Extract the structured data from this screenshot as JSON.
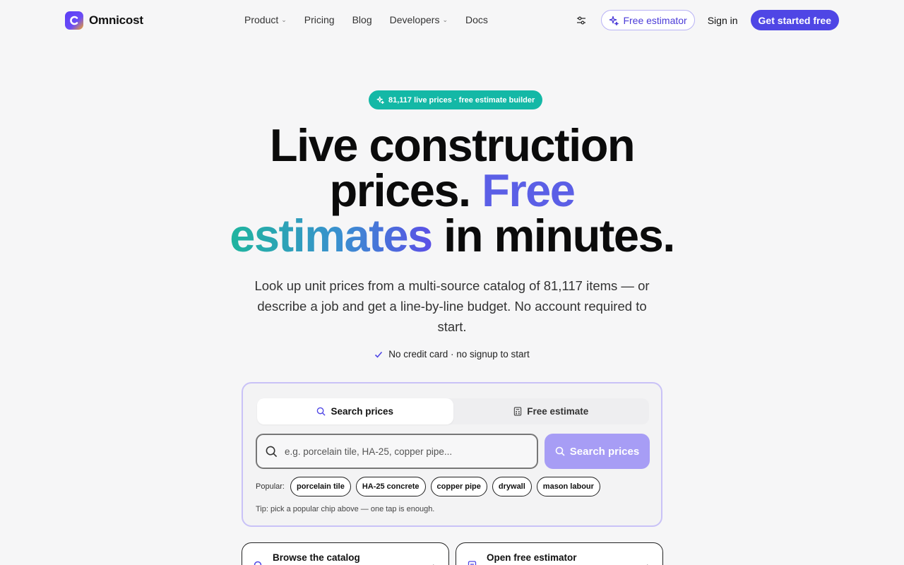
{
  "brand": {
    "name": "Omnicost"
  },
  "nav": {
    "links": [
      {
        "label": "Product",
        "dropdown": true
      },
      {
        "label": "Pricing",
        "dropdown": false
      },
      {
        "label": "Blog",
        "dropdown": false
      },
      {
        "label": "Developers",
        "dropdown": true
      },
      {
        "label": "Docs",
        "dropdown": false
      }
    ],
    "free_estimator_label": "Free estimator",
    "signin_label": "Sign in",
    "cta_label": "Get started free"
  },
  "hero": {
    "pill": "81,117 live prices · free estimate builder",
    "headline": {
      "line1": "Live construction",
      "line2_a": "prices. ",
      "line2_b": "Free",
      "line3_a": "estimates",
      "line3_b": " in minutes."
    },
    "subtitle": "Look up unit prices from a multi-source catalog of 81,117 items — or describe a job and get a line-by-line budget. No account required to start.",
    "note": "No credit card · no signup to start"
  },
  "search_card": {
    "tabs": [
      {
        "label": "Search prices",
        "active": true,
        "icon": "search-icon"
      },
      {
        "label": "Free estimate",
        "active": false,
        "icon": "calculator-icon"
      }
    ],
    "input_placeholder": "e.g. porcelain tile, HA-25, copper pipe...",
    "input_value": "",
    "button_label": "Search prices",
    "popular_label": "Popular:",
    "chips": [
      "porcelain tile",
      "HA-25 concrete",
      "copper pipe",
      "drywall",
      "mason labour"
    ],
    "tip": "Tip: pick a popular chip above — one tap is enough."
  },
  "bottom_cards": [
    {
      "title": "Browse the catalog",
      "icon": "search-icon"
    },
    {
      "title": "Open free estimator",
      "icon": "document-icon"
    }
  ],
  "colors": {
    "primary": "#4f46e5",
    "pill": "#14b8a6",
    "search_button": "#a79df5",
    "card_border": "#c9c2f7"
  }
}
